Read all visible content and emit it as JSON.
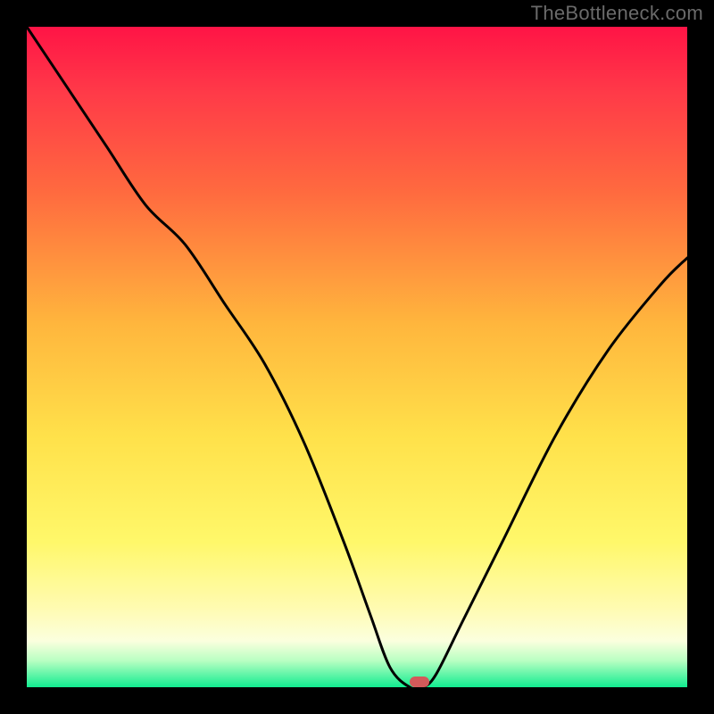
{
  "watermark": "TheBottleneck.com",
  "colors": {
    "curve_stroke": "#000000",
    "marker_fill": "#d35a5a",
    "frame_bg": "#000000"
  },
  "chart_data": {
    "type": "line",
    "title": "",
    "xlabel": "",
    "ylabel": "",
    "xlim": [
      0,
      100
    ],
    "ylim": [
      0,
      100
    ],
    "grid": false,
    "legend": false,
    "series": [
      {
        "name": "bottleneck-curve",
        "x": [
          0,
          6,
          12,
          18,
          24,
          30,
          36,
          42,
          48,
          52,
          55,
          58,
          60,
          62,
          66,
          72,
          80,
          88,
          96,
          100
        ],
        "values": [
          100,
          91,
          82,
          73,
          67,
          58,
          49,
          37,
          22,
          11,
          3,
          0,
          0,
          2,
          10,
          22,
          38,
          51,
          61,
          65
        ]
      }
    ],
    "marker": {
      "x": 59.5,
      "y": 0,
      "width_pct": 3,
      "height_pct": 1.6
    }
  }
}
